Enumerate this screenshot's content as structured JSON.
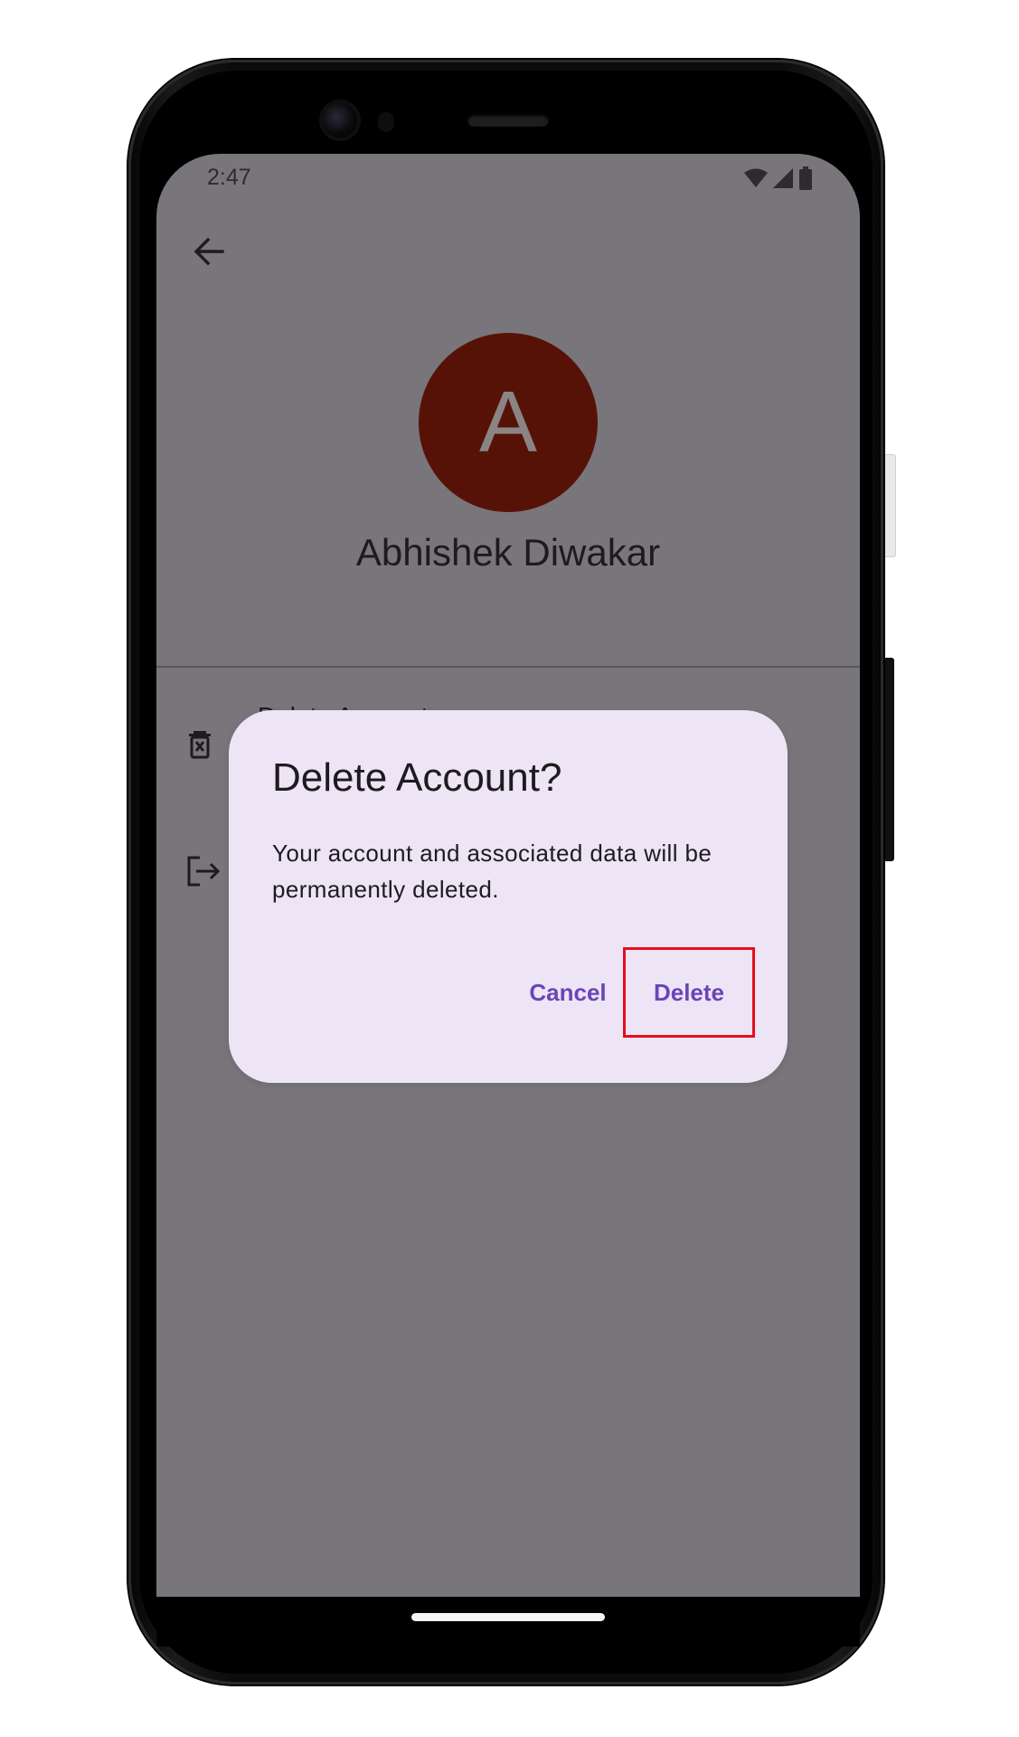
{
  "status_bar": {
    "time": "2:47",
    "icons": [
      "wifi-icon",
      "cellular-signal-icon",
      "battery-icon"
    ]
  },
  "header": {
    "back_icon": "arrow-left-icon"
  },
  "profile": {
    "avatar_letter": "A",
    "avatar_color": "#571208",
    "name": "Abhishek Diwakar"
  },
  "menu": {
    "items": [
      {
        "label": "Delete Account",
        "icon": "delete-box-icon"
      },
      {
        "label": "",
        "icon": "logout-icon"
      }
    ]
  },
  "dialog": {
    "title": "Delete Account?",
    "body": "Your account and associated data will be permanently deleted.",
    "cancel_label": "Cancel",
    "delete_label": "Delete",
    "accent_color": "#6945b8",
    "highlight_color": "#e3101c",
    "background_color": "#ede4f5"
  },
  "scrim_color": "#78767a"
}
